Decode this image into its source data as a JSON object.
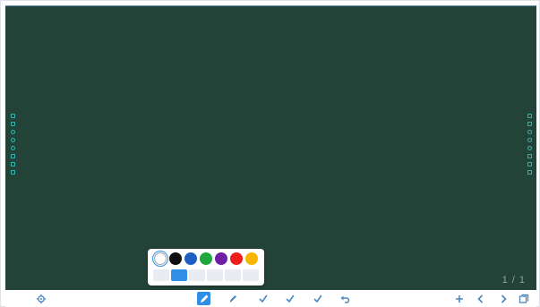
{
  "board": {
    "background": "#244338",
    "page_indicator": "1 / 1"
  },
  "side_tools": {
    "left": [
      "square",
      "square",
      "circle",
      "circle",
      "circle",
      "square",
      "square",
      "square"
    ],
    "right": [
      "square",
      "square",
      "circle",
      "circle",
      "circle",
      "square",
      "square",
      "square"
    ]
  },
  "pen_popup": {
    "colors": [
      {
        "name": "white",
        "hex": "#ffffff",
        "selected": true
      },
      {
        "name": "black",
        "hex": "#101010",
        "selected": false
      },
      {
        "name": "blue",
        "hex": "#1f5fc1",
        "selected": false
      },
      {
        "name": "green",
        "hex": "#1ea83e",
        "selected": false
      },
      {
        "name": "purple",
        "hex": "#6e1fa6",
        "selected": false
      },
      {
        "name": "red",
        "hex": "#f01d1d",
        "selected": false
      },
      {
        "name": "yellow",
        "hex": "#f7b500",
        "selected": false
      }
    ],
    "sizes": [
      {
        "level": 1,
        "selected": false
      },
      {
        "level": 2,
        "selected": true
      },
      {
        "level": 3,
        "selected": false
      },
      {
        "level": 4,
        "selected": false
      },
      {
        "level": 5,
        "selected": false
      },
      {
        "level": 6,
        "selected": false
      }
    ]
  },
  "toolbar": {
    "accent": "#2f8fe6",
    "icon_color": "#4b86bd",
    "left_tools": [
      {
        "name": "settings-icon",
        "icon": "gear"
      }
    ],
    "center_tools": [
      {
        "name": "pen-icon",
        "icon": "pen",
        "active": true
      },
      {
        "name": "marker-icon",
        "icon": "marker",
        "active": false
      },
      {
        "name": "eraser-icon",
        "icon": "check",
        "active": false
      },
      {
        "name": "shape-icon",
        "icon": "check",
        "active": false
      },
      {
        "name": "select-icon",
        "icon": "check",
        "active": false
      },
      {
        "name": "undo-icon",
        "icon": "undo",
        "active": false
      }
    ],
    "right_tools": [
      {
        "name": "add-page-icon",
        "icon": "plus"
      },
      {
        "name": "previous-page-icon",
        "icon": "chevron-left"
      },
      {
        "name": "next-page-icon",
        "icon": "chevron-right"
      },
      {
        "name": "pages-icon",
        "icon": "pages"
      }
    ]
  }
}
